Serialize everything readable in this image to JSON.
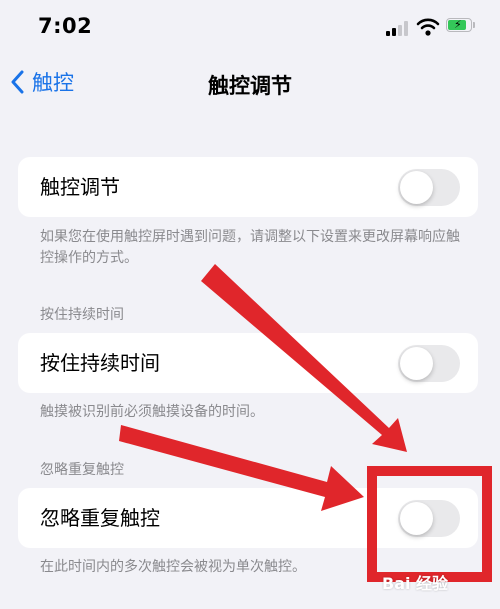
{
  "status_bar": {
    "time": "7:02",
    "signal_icon": "cellular-signal-icon",
    "wifi_icon": "wifi-icon",
    "battery_icon": "battery-charging-icon",
    "battery_color": "#34c759"
  },
  "nav": {
    "back_label": "触控",
    "title": "触控调节",
    "accent_color": "#1a73e8"
  },
  "touch_accommodations": {
    "label": "触控调节",
    "toggle_on": false,
    "footer": "如果您在使用触控屏时遇到问题，请调整以下设置来更改屏幕响应触控操作的方式。"
  },
  "hold_duration": {
    "header": "按住持续时间",
    "label": "按住持续时间",
    "toggle_on": false,
    "footer": "触摸被识别前必须触摸设备的时间。"
  },
  "ignore_repeat": {
    "header": "忽略重复触控",
    "label": "忽略重复触控",
    "toggle_on": false,
    "footer": "在此时间内的多次触控会被视为单次触控。"
  },
  "annotations": {
    "arrow_color": "#e0262b",
    "highlight_color": "#e0262b"
  },
  "watermark": {
    "text": "Bai 经验"
  }
}
